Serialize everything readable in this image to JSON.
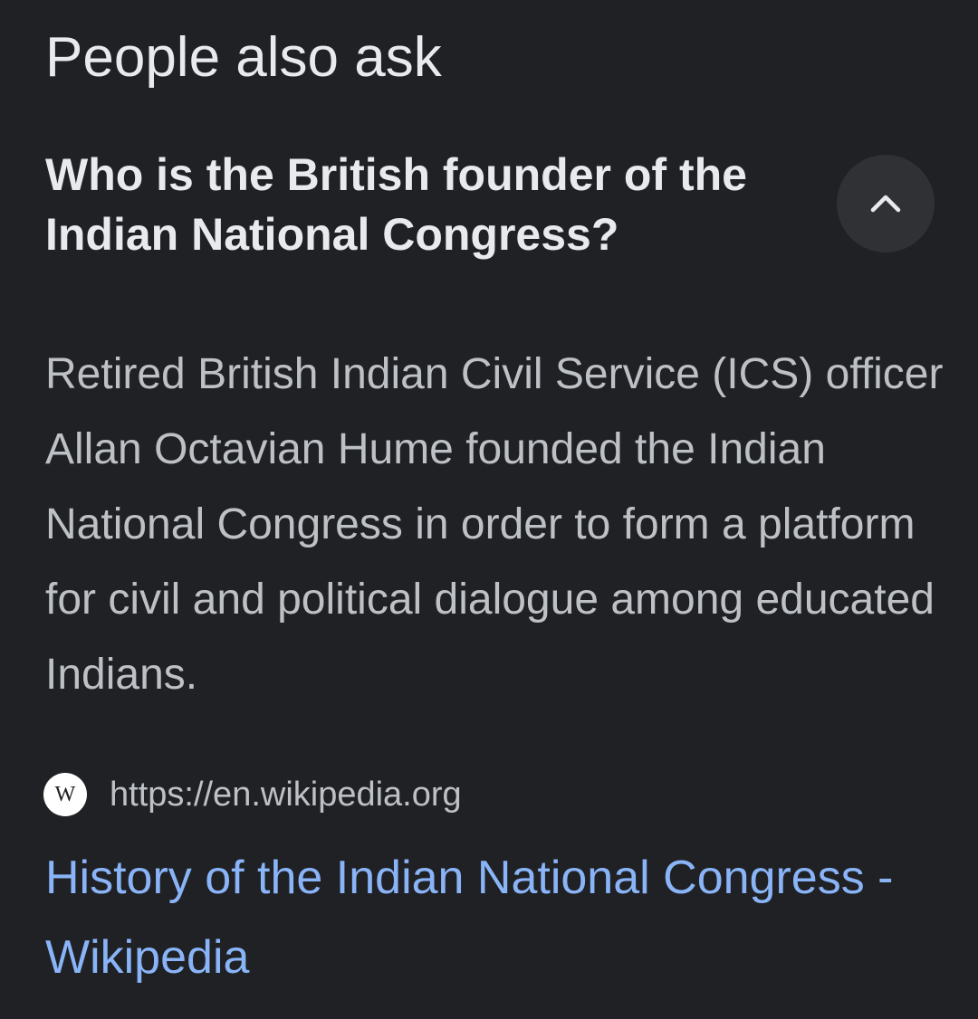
{
  "section": {
    "title": "People also ask"
  },
  "question": {
    "text": "Who is the British founder of the Indian National Congress?",
    "expanded": true,
    "toggle_icon": "chevron-up-icon"
  },
  "answer": {
    "text": "Retired British Indian Civil Service (ICS) officer Allan Octavian Hume founded the Indian National Congress in order to form a platform for civil and political dialogue among educated Indians."
  },
  "source": {
    "favicon_letter": "W",
    "favicon_icon": "wikipedia-icon",
    "url": "https://en.wikipedia.org"
  },
  "result": {
    "title": "History of the Indian National Congress - Wikipedia"
  },
  "colors": {
    "background": "#202124",
    "title_text": "#e8eaed",
    "body_text": "#bdc1c6",
    "link": "#8ab4f8",
    "toggle_background": "#303134"
  }
}
